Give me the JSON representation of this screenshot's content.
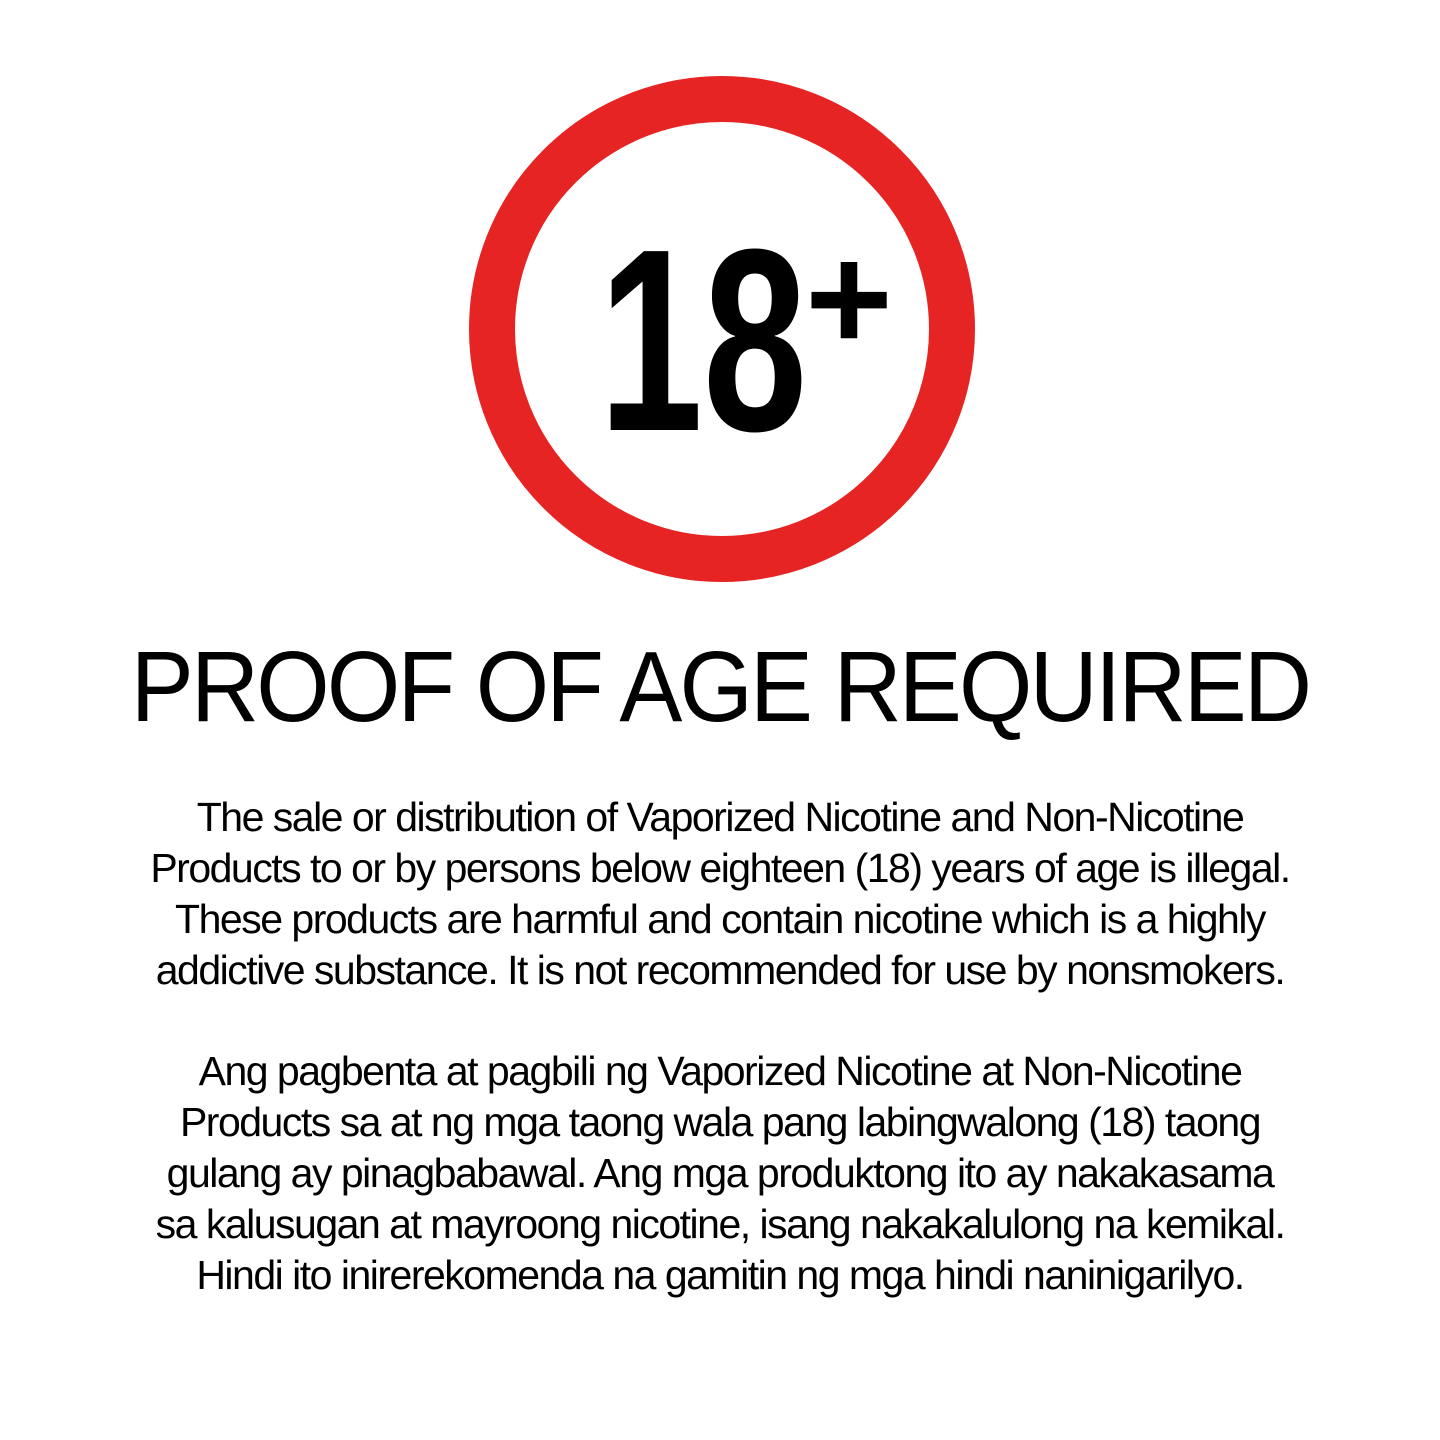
{
  "badge": {
    "number": "18",
    "plus": "+",
    "ring_color": "#e52423",
    "fill_color": "#ffffff",
    "text_color": "#000000"
  },
  "headline": "PROOF OF AGE REQUIRED",
  "english_notice": [
    "The sale or distribution of Vaporized Nicotine and Non-Nicotine",
    "Products to or by persons below eighteen (18) years of age is illegal.",
    "These products are harmful and contain nicotine which is a highly",
    "addictive substance. It is not recommended for use by nonsmokers."
  ],
  "filipino_notice": [
    "Ang pagbenta at pagbili ng Vaporized Nicotine at Non-Nicotine",
    "Products sa at ng mga taong wala pang labingwalong (18) taong",
    "gulang ay pinagbabawal. Ang mga produktong ito ay nakakasama",
    "sa kalusugan at mayroong nicotine, isang nakakalulong na kemikal.",
    "Hindi ito inirerekomenda na gamitin ng mga hindi naninigarilyo."
  ]
}
